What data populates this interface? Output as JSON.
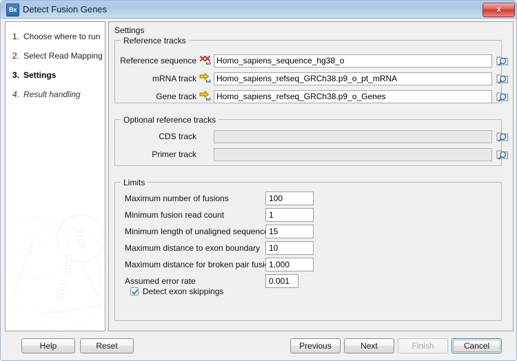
{
  "window": {
    "title": "Detect Fusion Genes",
    "app_icon": "Bx",
    "close_label": "x",
    "close_icon": "close-icon"
  },
  "sidebar": {
    "steps": [
      {
        "num": "1.",
        "label": "Choose where to run",
        "state": "done"
      },
      {
        "num": "2.",
        "label": "Select Read Mapping",
        "state": "done"
      },
      {
        "num": "3.",
        "label": "Settings",
        "state": "current"
      },
      {
        "num": "4.",
        "label": "Result handling",
        "state": "future"
      }
    ]
  },
  "content": {
    "header": "Settings",
    "reference_tracks": {
      "title": "Reference tracks",
      "fields": [
        {
          "label": "Reference sequence",
          "value": "Homo_sapiens_sequence_hg38_o",
          "icon": "chromosome-track-icon",
          "browse_icon": "folder-browse-icon"
        },
        {
          "label": "mRNA track",
          "value": "Homo_sapiens_refseq_GRCh38.p9_o_pt_mRNA",
          "icon": "arrow-track-icon",
          "browse_icon": "folder-browse-icon"
        },
        {
          "label": "Gene track",
          "value": "Homo_sapiens_refseq_GRCh38.p9_o_Genes",
          "icon": "arrow-track-icon",
          "browse_icon": "folder-browse-icon"
        }
      ]
    },
    "optional_reference_tracks": {
      "title": "Optional reference tracks",
      "fields": [
        {
          "label": "CDS track",
          "value": "",
          "browse_icon": "folder-browse-icon"
        },
        {
          "label": "Primer track",
          "value": "",
          "browse_icon": "folder-browse-icon"
        }
      ]
    },
    "limits": {
      "title": "Limits",
      "fields": [
        {
          "label": "Maximum number of fusions",
          "value": "100"
        },
        {
          "label": "Minimum fusion read count",
          "value": "1"
        },
        {
          "label": "Minimum length of unaligned sequence",
          "value": "15"
        },
        {
          "label": "Maximum distance to exon boundary",
          "value": "10"
        },
        {
          "label": "Maximum distance for broken pair fusions",
          "value": "1,000"
        },
        {
          "label": "Assumed error rate",
          "value": "0.001"
        }
      ],
      "checkbox": {
        "label": "Detect exon skippings",
        "checked": true
      }
    }
  },
  "buttons": {
    "help": "Help",
    "reset": "Reset",
    "previous": "Previous",
    "next": "Next",
    "finish": "Finish",
    "cancel": "Cancel"
  },
  "colors": {
    "titlebar": "#aec8e4",
    "close_button": "#cf3c30",
    "accent_focus": "#3c7fb1",
    "panel_bg": "#f0f0f0",
    "track_icon_red": "#c0392b",
    "track_icon_yellow": "#f2c200"
  }
}
